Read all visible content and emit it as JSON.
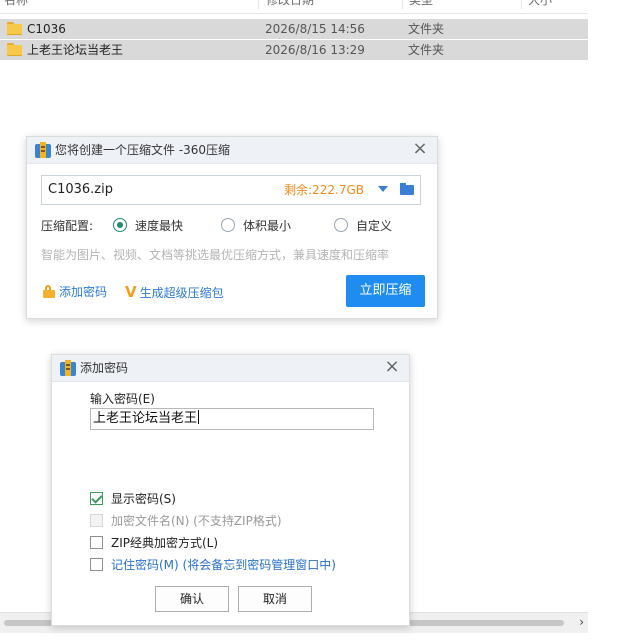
{
  "file_list": {
    "columns": [
      "名称",
      "修改日期",
      "类型",
      "大小"
    ],
    "rows": [
      {
        "name": "C1036",
        "modified": "2026/8/15 14:56",
        "type": "文件夹"
      },
      {
        "name": "上老王论坛当老王",
        "modified": "2026/8/16 13:29",
        "type": "文件夹"
      }
    ]
  },
  "compress_dialog": {
    "title": "您将创建一个压缩文件 -360压缩",
    "filename": "C1036.zip",
    "free_space": "剩余:222.7GB",
    "config_label": "压缩配置:",
    "options": [
      {
        "label": "速度最快",
        "selected": true
      },
      {
        "label": "体积最小",
        "selected": false
      },
      {
        "label": "自定义",
        "selected": false
      }
    ],
    "hint": "智能为图片、视频、文档等挑选最优压缩方式，兼具速度和压缩率",
    "add_password_link": "添加密码",
    "super_package_link": "生成超级压缩包",
    "compress_button": "立即压缩"
  },
  "password_dialog": {
    "title": "添加密码",
    "input_label": "输入密码(E)",
    "password_value": "上老王论坛当老王",
    "checkboxes": [
      {
        "label": "显示密码(S)",
        "checked": true,
        "enabled": true
      },
      {
        "label": "加密文件名(N) (不支持ZIP格式)",
        "checked": false,
        "enabled": false
      },
      {
        "label": "ZIP经典加密方式(L)",
        "checked": false,
        "enabled": true
      },
      {
        "label": "记住密码(M) (将会备忘到密码管理窗口中)",
        "checked": false,
        "enabled": true
      }
    ],
    "ok_button": "确认",
    "cancel_button": "取消"
  },
  "scrollbar": {
    "right_arrow": "›"
  },
  "colors": {
    "accent_blue": "#1e8cf0",
    "free_space_orange": "#f08a1c",
    "radio_green": "#1e8a6e",
    "row_selected": "#d9d9d9"
  }
}
